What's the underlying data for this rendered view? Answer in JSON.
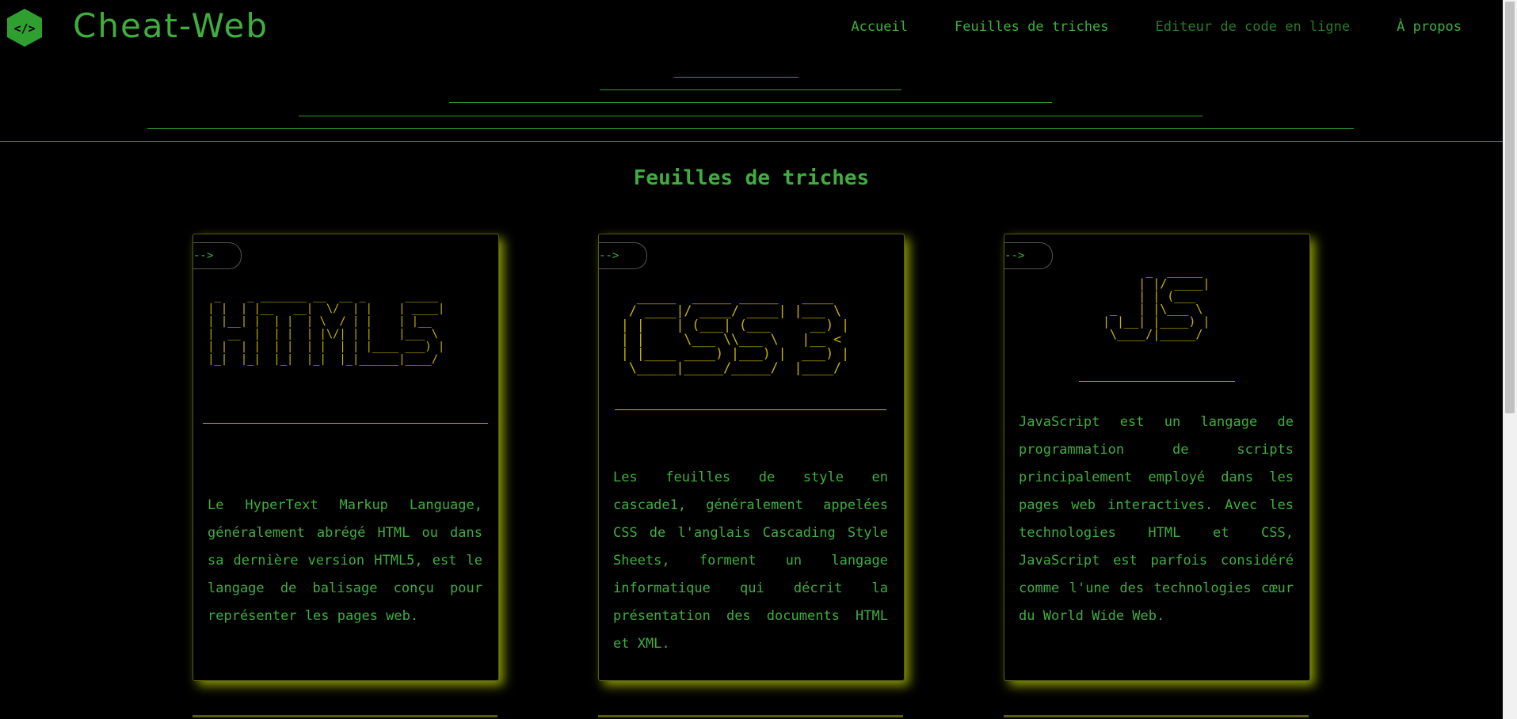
{
  "header": {
    "brand": "Cheat-Web",
    "nav": [
      {
        "label": "Accueil"
      },
      {
        "label": "Feuilles de triches"
      },
      {
        "label": "Editeur de code en ligne"
      },
      {
        "label": "À propos"
      }
    ]
  },
  "main": {
    "title": "Feuilles de triches",
    "cards": [
      {
        "tag": "-->",
        "ascii": "  _    _ _______ __  __ _      _____ \n | |  | |__   __|  \\/  | |    | ____|\n | |__| |  | |  | \\  / | |    | |__  \n |  __  |  | |  | |\\/| | |    |___ \\ \n | |  | |  | |  | |  | | |____ ___) |\n |_|  |_|  |_|  |_|  |_|______|____/ ",
        "description": "Le HyperText Markup Language, généralement abrégé HTML ou dans sa dernière version HTML5, est le langage de balisage conçu pour représenter les pages web."
      },
      {
        "tag": "-->",
        "ascii": "   _____  _____ _____   ____  \n  / ____|/ ____/ ____| |___ \\ \n | |    | (___| (___     __) |\n | |     \\___ \\\\___ \\   |__ < \n | |____ ____) |___) |  ___) |\n  \\_____|_____/_____/  |____/ ",
        "description": "Les feuilles de style en cascade1, généralement appelées CSS de l'anglais Cascading Style Sheets, forment un langage informatique qui décrit la présentation des documents HTML et XML."
      },
      {
        "tag": "-->",
        "ascii": "      _  _____ \n     | |/ ____|\n     | | (___  \n _   | |\\___ \\ \n| |__| |____) |\n \\____/|_____/ ",
        "description": "JavaScript est un langage de programmation de scripts principalement employé dans les pages web interactives. Avec les technologies HTML et CSS, JavaScript est parfois considéré comme l'une des technologies cœur du World Wide Web."
      }
    ]
  }
}
